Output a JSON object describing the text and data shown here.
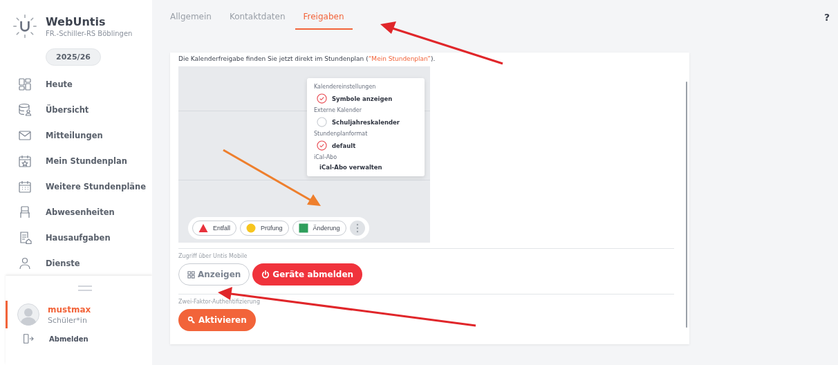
{
  "brand": {
    "title": "WebUntis",
    "school": "FR.-Schiller-RS Böblingen",
    "school_year": "2025/26"
  },
  "nav": [
    {
      "label": "Heute"
    },
    {
      "label": "Übersicht"
    },
    {
      "label": "Mitteilungen"
    },
    {
      "label": "Mein Stundenplan"
    },
    {
      "label": "Weitere Stundenpläne"
    },
    {
      "label": "Abwesenheiten"
    },
    {
      "label": "Hausaufgaben"
    },
    {
      "label": "Dienste"
    }
  ],
  "user": {
    "name": "mustmax",
    "role": "Schüler*in",
    "selected": true
  },
  "logout": "Abmelden",
  "help": "?",
  "tabs": [
    {
      "label": "Allgemein",
      "selected": false
    },
    {
      "label": "Kontaktdaten",
      "selected": false
    },
    {
      "label": "Freigaben",
      "selected": true
    }
  ],
  "intro": {
    "before": "Die Kalenderfreigabe finden Sie jetzt direkt im Stundenplan (",
    "link": "“Mein Stundenplan”",
    "after": ")."
  },
  "preview": {
    "menu": [
      {
        "heading": "Kalendereinstellungen",
        "options": [
          {
            "label": "Symbole anzeigen",
            "kind": "radio",
            "checked": true
          }
        ]
      },
      {
        "heading": "Externe Kalender",
        "options": [
          {
            "label": "Schuljahreskalender",
            "kind": "radio",
            "checked": false
          }
        ]
      },
      {
        "heading": "Stundenplanformat",
        "options": [
          {
            "label": "default",
            "kind": "radio",
            "checked": true
          }
        ]
      },
      {
        "heading": "iCal-Abo",
        "options": [
          {
            "label": "iCal-Abo verwalten",
            "kind": "link"
          }
        ]
      }
    ],
    "legend": [
      {
        "label": "Entfall",
        "kind": "triangle",
        "color": "#e8323c"
      },
      {
        "label": "Prüfung",
        "kind": "circle",
        "color": "#f7c51e"
      },
      {
        "label": "Änderung",
        "kind": "square",
        "color": "#2e9e5b"
      }
    ]
  },
  "sections": [
    {
      "label": "Zugriff über Untis Mobile",
      "buttons": [
        {
          "label": "Anzeigen",
          "kind": "outline"
        },
        {
          "label": "Geräte abmelden",
          "kind": "danger"
        }
      ]
    },
    {
      "label": "Zwei-Faktor-Authentifizierung",
      "buttons": [
        {
          "label": "Aktivieren",
          "kind": "primary"
        }
      ]
    }
  ]
}
